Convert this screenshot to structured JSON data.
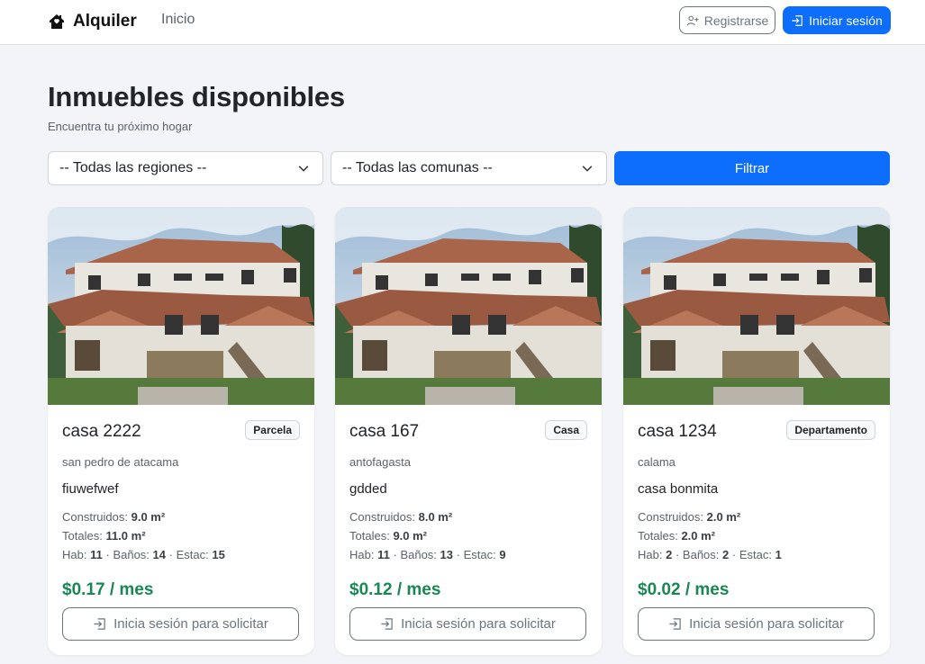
{
  "navbar": {
    "brand": "Alquiler",
    "brand_icon": "house-heart-icon",
    "home_link": "Inicio",
    "register_label": "Registrarse",
    "register_icon": "person-plus-icon",
    "login_label": "Iniciar sesión",
    "login_icon": "box-arrow-in-right-icon"
  },
  "header": {
    "title": "Inmuebles disponibles",
    "subtitle": "Encuentra tu próximo hogar"
  },
  "filters": {
    "region_selected": "-- Todas las regiones --",
    "comuna_selected": "-- Todas las comunas --",
    "filter_button": "Filtrar"
  },
  "colors": {
    "primary": "#0d6efd",
    "success": "#198754",
    "background": "#f3f4f8"
  },
  "labels": {
    "construidos": "Construidos:",
    "totales": "Totales:",
    "hab": "Hab:",
    "banos": "Baños:",
    "estac": "Estac:",
    "separator": "·",
    "unit_m2": "m²"
  },
  "cards": [
    {
      "title": "casa 2222",
      "type": "Parcela",
      "location": "san pedro de atacama",
      "description": "fiuwefwef",
      "construidos": "9.0 m²",
      "totales": "11.0 m²",
      "hab": "11",
      "banos": "14",
      "estac": "15",
      "price": "$0.17 / mes",
      "button": "Inicia sesión para solicitar"
    },
    {
      "title": "casa 167",
      "type": "Casa",
      "location": "antofagasta",
      "description": "gdded",
      "construidos": "8.0 m²",
      "totales": "9.0 m²",
      "hab": "11",
      "banos": "13",
      "estac": "9",
      "price": "$0.12 / mes",
      "button": "Inicia sesión para solicitar"
    },
    {
      "title": "casa 1234",
      "type": "Departamento",
      "location": "calama",
      "description": "casa bonmita",
      "construidos": "2.0 m²",
      "totales": "2.0 m²",
      "hab": "2",
      "banos": "2",
      "estac": "1",
      "price": "$0.02 / mes",
      "button": "Inicia sesión para solicitar"
    }
  ]
}
